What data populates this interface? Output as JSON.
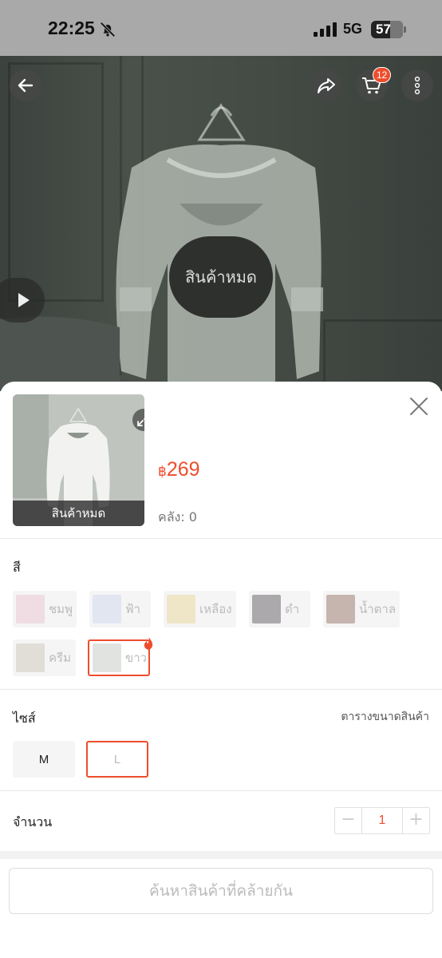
{
  "status_bar": {
    "time": "22:25",
    "network": "5G",
    "battery": "57"
  },
  "header": {
    "cart_count": "12"
  },
  "hero": {
    "soldout_label": "สินค้าหมด"
  },
  "product": {
    "thumb_soldout_label": "สินค้าหมด",
    "currency": "฿",
    "price": "269",
    "stock_label": "คลัง: 0"
  },
  "color": {
    "label": "สี",
    "options": [
      {
        "label": "ชมพู",
        "swatch": "#e9c8d4"
      },
      {
        "label": "ฟ้า",
        "swatch": "#cfd8ec"
      },
      {
        "label": "เหลือง",
        "swatch": "#ead9a2"
      },
      {
        "label": "ดำ",
        "swatch": "#6e6a6e"
      },
      {
        "label": "น้ำตาล",
        "swatch": "#9c8073"
      },
      {
        "label": "ครีม",
        "swatch": "#cfcac0"
      },
      {
        "label": "ขาว",
        "swatch": "#c8ccc8",
        "selected": true,
        "hot": true
      }
    ]
  },
  "size": {
    "label": "ไซส์",
    "chart_link": "ตารางขนาดสินค้า",
    "options": [
      "M",
      "L"
    ],
    "selected": "L"
  },
  "quantity": {
    "label": "จำนวน",
    "value": "1",
    "minus": "−",
    "plus": "+"
  },
  "footer": {
    "similar_button": "ค้นหาสินค้าที่คล้ายกัน"
  },
  "colors": {
    "accent": "#ee4d2d"
  }
}
